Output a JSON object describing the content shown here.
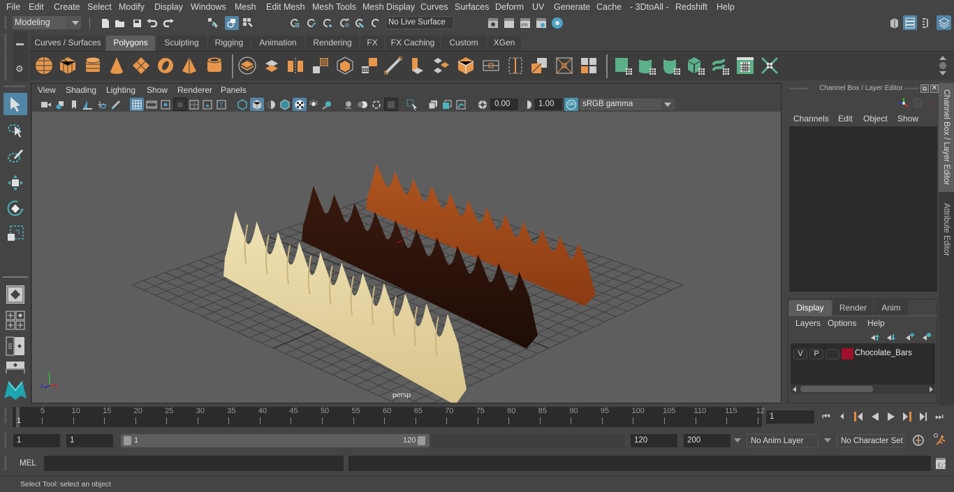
{
  "menu": [
    "File",
    "Edit",
    "Create",
    "Select",
    "Modify",
    "Display",
    "Windows",
    "Mesh",
    "Edit Mesh",
    "Mesh Tools",
    "Mesh Display",
    "Curves",
    "Surfaces",
    "Deform",
    "UV",
    "Generate",
    "Cache",
    "- 3DtoAll -",
    "Redshift",
    "Help"
  ],
  "toolbar": {
    "mode": "Modeling",
    "live_surface": "No Live Surface"
  },
  "shelf": {
    "tabs": [
      "Curves / Surfaces",
      "Polygons",
      "Sculpting",
      "Rigging",
      "Animation",
      "Rendering",
      "FX",
      "FX Caching",
      "Custom",
      "XGen"
    ],
    "active_tab": "Polygons"
  },
  "viewport": {
    "menu": [
      "View",
      "Shading",
      "Lighting",
      "Show",
      "Renderer",
      "Panels"
    ],
    "exposure": "0.00",
    "gamma": "1.00",
    "color_mgmt_toggle": "ON",
    "color_space": "sRGB gamma",
    "camera_label": "persp",
    "axis_labels": {
      "x": "x",
      "y": "y",
      "z": "z"
    },
    "objects": [
      {
        "name": "white-chocolate-bar",
        "color": "#e8d7a4"
      },
      {
        "name": "dark-chocolate-bar",
        "color": "#2a130b"
      },
      {
        "name": "milk-chocolate-bar",
        "color": "#9c4418"
      }
    ]
  },
  "channel_box": {
    "title": "Channel Box / Layer Editor",
    "menu": [
      "Channels",
      "Edit",
      "Object",
      "Show"
    ]
  },
  "layer_editor": {
    "tabs": [
      "Display",
      "Render",
      "Anim"
    ],
    "active_tab": "Display",
    "menu": [
      "Layers",
      "Options",
      "Help"
    ],
    "layers": [
      {
        "visible": "V",
        "playback": "P",
        "name": "Chocolate_Bars",
        "color": "#a0102a"
      }
    ]
  },
  "side_tabs": [
    "Channel Box / Layer Editor",
    "Attribute Editor"
  ],
  "timeline": {
    "ticks": [
      "5",
      "10",
      "15",
      "20",
      "25",
      "30",
      "35",
      "40",
      "45",
      "50",
      "55",
      "60",
      "65",
      "70",
      "75",
      "80",
      "85",
      "90",
      "95",
      "100",
      "105",
      "110",
      "115",
      "12"
    ],
    "current_frame_marker": "1",
    "current_frame": "1"
  },
  "range": {
    "start": "1",
    "playback_start": "1",
    "slider_start": "1",
    "slider_end": "120",
    "playback_end": "120",
    "end": "200",
    "anim_layer": "No Anim Layer",
    "character_set": "No Character Set"
  },
  "command": {
    "label": "MEL",
    "input": ""
  },
  "status": "Select Tool: select an object"
}
